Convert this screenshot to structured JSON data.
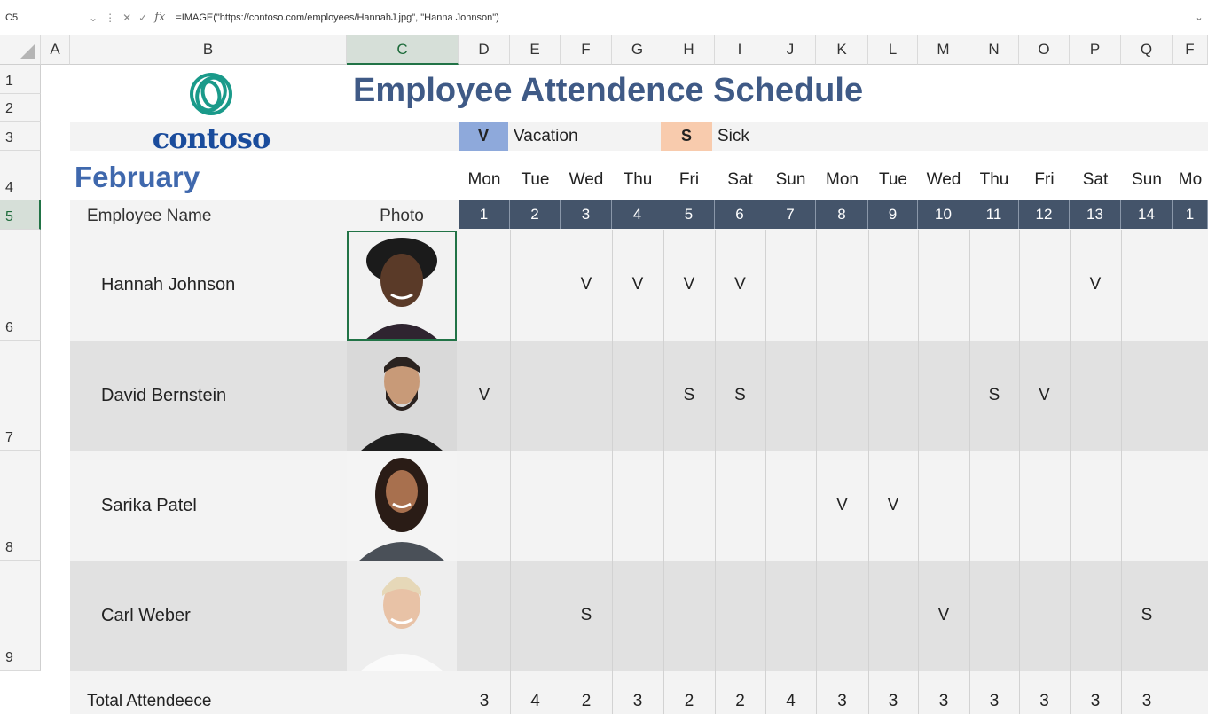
{
  "formula_bar": {
    "name_box": "C5",
    "formula": "=IMAGE(\"https://contoso.com/employees/HannahJ.jpg\", \"Hanna Johnson\")",
    "fx_label": "fx"
  },
  "columns": [
    "A",
    "B",
    "C",
    "D",
    "E",
    "F",
    "G",
    "H",
    "I",
    "J",
    "K",
    "L",
    "M",
    "N",
    "O",
    "P",
    "Q",
    "F"
  ],
  "selected_column": "C",
  "rows": [
    "1",
    "2",
    "3",
    "4",
    "5",
    "6",
    "7",
    "8",
    "9"
  ],
  "selected_row": "5",
  "logo": {
    "text": "contoso",
    "color": "#1a9a8a"
  },
  "title": "Employee Attendence Schedule",
  "legend": [
    {
      "code": "V",
      "label": "Vacation",
      "color": "#8ea9db"
    },
    {
      "code": "S",
      "label": "Sick",
      "color": "#f8cbad"
    }
  ],
  "month": "February",
  "headers": {
    "name": "Employee Name",
    "photo": "Photo"
  },
  "days": [
    "Mon",
    "Tue",
    "Wed",
    "Thu",
    "Fri",
    "Sat",
    "Sun",
    "Mon",
    "Tue",
    "Wed",
    "Thu",
    "Fri",
    "Sat",
    "Sun",
    "Mo"
  ],
  "dates": [
    "1",
    "2",
    "3",
    "4",
    "5",
    "6",
    "7",
    "8",
    "9",
    "10",
    "11",
    "12",
    "13",
    "14",
    "1"
  ],
  "employees": [
    {
      "name": "Hannah Johnson",
      "marks": [
        "",
        "",
        "V",
        "V",
        "V",
        "V",
        "",
        "",
        "",
        "",
        "",
        "",
        "V",
        "",
        ""
      ]
    },
    {
      "name": "David Bernstein",
      "marks": [
        "V",
        "",
        "",
        "",
        "S",
        "S",
        "",
        "",
        "",
        "",
        "S",
        "V",
        "",
        "",
        ""
      ]
    },
    {
      "name": "Sarika Patel",
      "marks": [
        "",
        "",
        "",
        "",
        "",
        "",
        "",
        "V",
        "V",
        "",
        "",
        "",
        "",
        "",
        ""
      ]
    },
    {
      "name": "Carl Weber",
      "marks": [
        "",
        "",
        "S",
        "",
        "",
        "",
        "",
        "",
        "",
        "V",
        "",
        "",
        "",
        "S",
        ""
      ]
    }
  ],
  "total": {
    "label": "Total Attendeece",
    "values": [
      "3",
      "4",
      "2",
      "3",
      "2",
      "2",
      "4",
      "3",
      "3",
      "3",
      "3",
      "3",
      "3",
      "3",
      ""
    ]
  },
  "colors": {
    "title": "#3f5a86",
    "month": "#3f68ad",
    "date_header_bg": "#44546a",
    "selection": "#217346"
  }
}
